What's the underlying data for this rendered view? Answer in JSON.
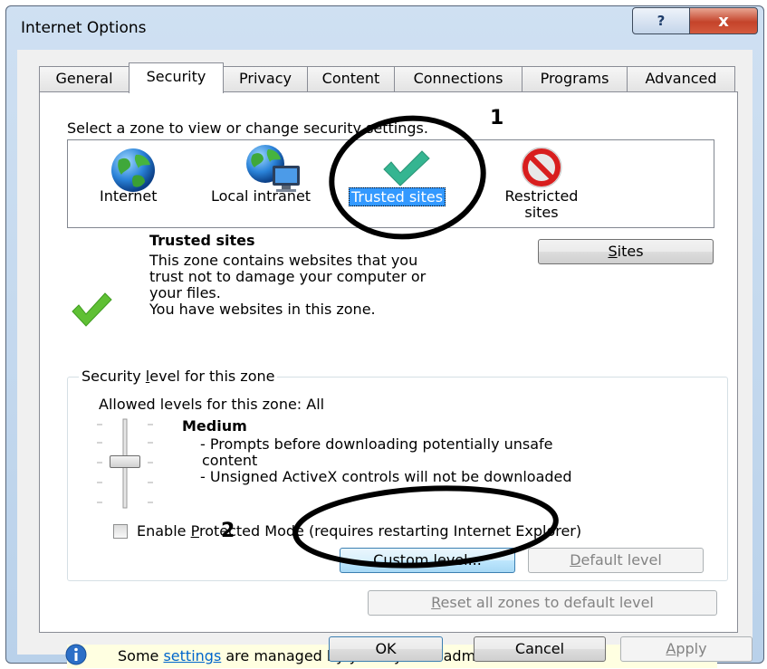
{
  "window": {
    "title": "Internet Options",
    "help_glyph": "?",
    "close_glyph": "x"
  },
  "tabs": [
    {
      "label": "General"
    },
    {
      "label": "Security"
    },
    {
      "label": "Privacy"
    },
    {
      "label": "Content"
    },
    {
      "label": "Connections"
    },
    {
      "label": "Programs"
    },
    {
      "label": "Advanced"
    }
  ],
  "security": {
    "zone_prompt": "Select a zone to view or change security settings.",
    "zones": [
      {
        "label": "Internet",
        "icon": "globe-icon"
      },
      {
        "label": "Local intranet",
        "icon": "intranet-icon"
      },
      {
        "label": "Trusted sites",
        "icon": "checkmark-icon",
        "selected": true
      },
      {
        "label_line1": "Restricted",
        "label_line2": "sites",
        "icon": "blocked-icon"
      }
    ],
    "zone_info": {
      "title": "Trusted sites",
      "desc_line1": "This zone contains websites that you",
      "desc_line2": "trust not to damage your computer or",
      "desc_line3": "your files.",
      "desc_line4": "You have websites in this zone."
    },
    "sites_button": {
      "accel": "S",
      "rest": "ites"
    },
    "level_group": {
      "title_pre": "Security ",
      "title_accel": "l",
      "title_post": "evel for this zone",
      "allowed": "Allowed levels for this zone: All",
      "level_name": "Medium",
      "bullet1_line1": "- Prompts before downloading potentially unsafe",
      "bullet1_line2": "content",
      "bullet2": "- Unsigned ActiveX controls will not be downloaded",
      "protected_mode_pre": "Enable ",
      "protected_mode_accel": "P",
      "protected_mode_post": "rotected Mode (requires restarting Internet Explorer)",
      "protected_mode_checked": false,
      "custom_button": {
        "accel": "C",
        "rest": "ustom level..."
      },
      "default_button": {
        "accel": "D",
        "rest": "efault level"
      }
    },
    "reset_button": {
      "accel": "R",
      "rest": "eset all zones to default level"
    },
    "admin_notice": {
      "pre": "Some ",
      "link": "settings",
      "post": " are managed by your system administrator."
    }
  },
  "footer": {
    "ok": "OK",
    "cancel": "Cancel",
    "apply_accel": "A",
    "apply_rest": "pply"
  },
  "annotations": {
    "marker1": "1",
    "marker2": "2"
  },
  "colors": {
    "selection": "#3399ff",
    "annotation_ink": "#000000",
    "info_bar": "#ffffe1",
    "link": "#0066cc"
  }
}
